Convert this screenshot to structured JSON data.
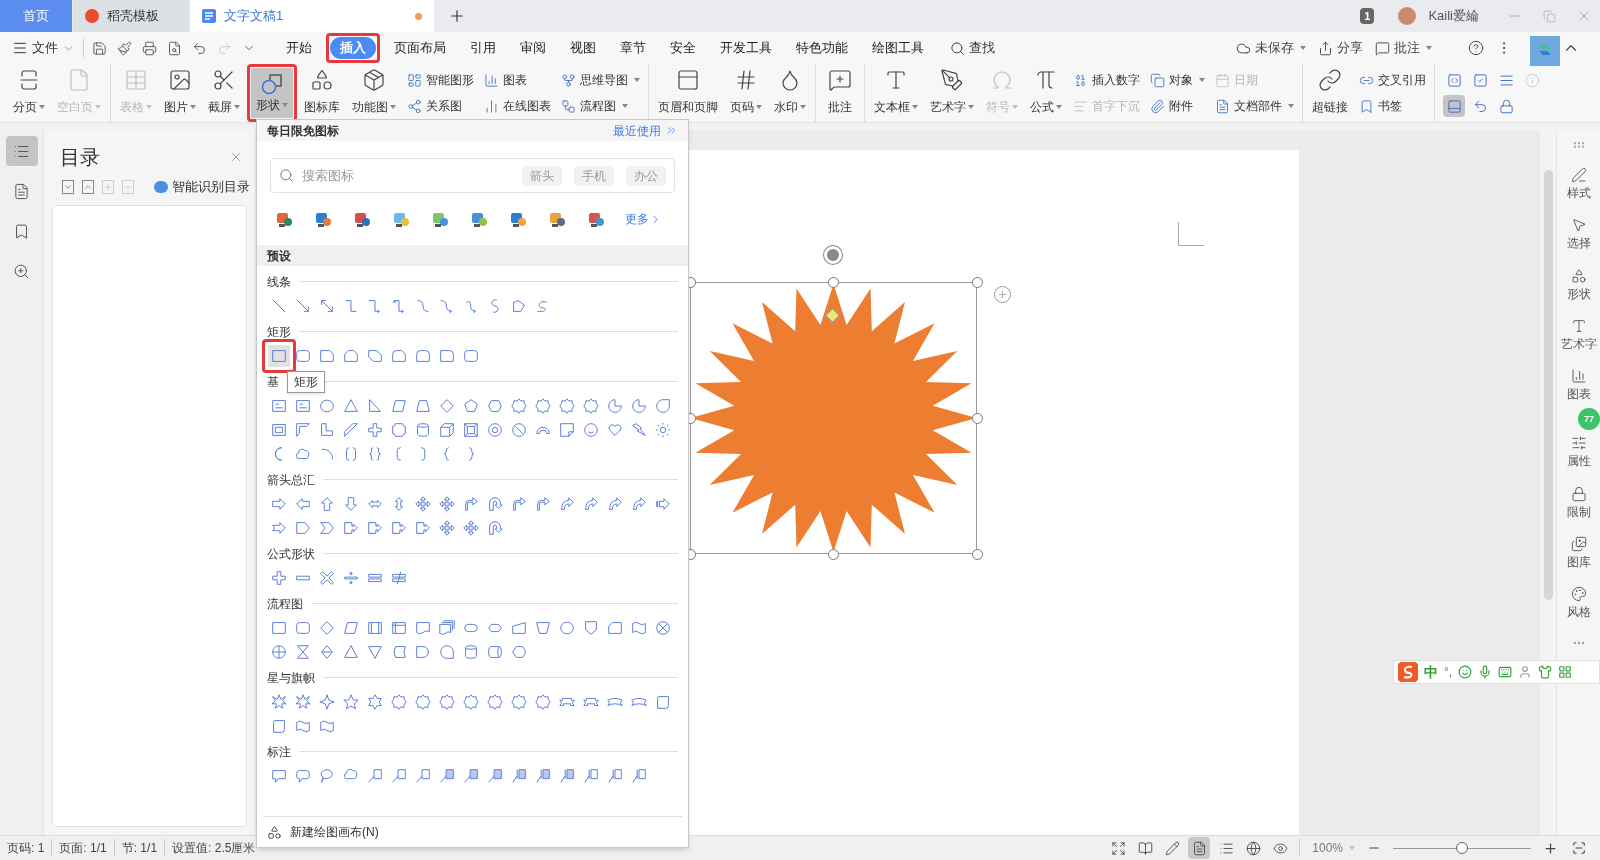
{
  "tabs": [
    {
      "label": "首页",
      "kind": "home",
      "selected": false,
      "unsaved": false
    },
    {
      "label": "稻壳模板",
      "kind": "template",
      "selected": false,
      "unsaved": false
    },
    {
      "label": "文字文稿1",
      "kind": "document",
      "selected": true,
      "unsaved": true
    }
  ],
  "account": {
    "page_count": "1",
    "name": "Kaili爱綸"
  },
  "menu": {
    "file": "文件",
    "items": [
      {
        "label": "开始",
        "selected": false,
        "annotated": false
      },
      {
        "label": "插入",
        "selected": true,
        "annotated": true
      },
      {
        "label": "页面布局",
        "selected": false,
        "annotated": false
      },
      {
        "label": "引用",
        "selected": false,
        "annotated": false
      },
      {
        "label": "审阅",
        "selected": false,
        "annotated": false
      },
      {
        "label": "视图",
        "selected": false,
        "annotated": false
      },
      {
        "label": "章节",
        "selected": false,
        "annotated": false
      },
      {
        "label": "安全",
        "selected": false,
        "annotated": false
      },
      {
        "label": "开发工具",
        "selected": false,
        "annotated": false
      },
      {
        "label": "特色功能",
        "selected": false,
        "annotated": false
      },
      {
        "label": "绘图工具",
        "selected": false,
        "annotated": false
      }
    ],
    "search": "查找",
    "right": [
      {
        "label": "未保存",
        "caret": true
      },
      {
        "label": "分享",
        "caret": false
      },
      {
        "label": "批注",
        "caret": true
      }
    ]
  },
  "ribbon": [
    {
      "items": [
        {
          "kind": "large",
          "label": "分页",
          "caret": true,
          "disabled": false,
          "pressed": false,
          "annotated": false
        },
        {
          "kind": "large",
          "label": "空白页",
          "caret": true,
          "disabled": true,
          "pressed": false,
          "annotated": false
        }
      ]
    },
    {
      "items": [
        {
          "kind": "large",
          "label": "表格",
          "caret": true,
          "disabled": true,
          "pressed": false,
          "annotated": false
        },
        {
          "kind": "large",
          "label": "图片",
          "caret": true,
          "disabled": false,
          "pressed": false,
          "annotated": false
        },
        {
          "kind": "large",
          "label": "截屏",
          "caret": true,
          "disabled": false,
          "pressed": false,
          "annotated": false
        },
        {
          "kind": "large",
          "label": "形状",
          "caret": true,
          "disabled": false,
          "pressed": true,
          "annotated": true
        },
        {
          "kind": "large",
          "label": "图标库",
          "caret": false,
          "disabled": false,
          "pressed": false,
          "annotated": false
        },
        {
          "kind": "large",
          "label": "功能图",
          "caret": true,
          "disabled": false,
          "pressed": false,
          "annotated": false
        },
        {
          "kind": "stack",
          "items": [
            {
              "label": "智能图形",
              "caret": false,
              "disabled": false
            },
            {
              "label": "关系图",
              "caret": false,
              "disabled": false
            }
          ]
        },
        {
          "kind": "stack",
          "items": [
            {
              "label": "图表",
              "caret": false,
              "disabled": false
            },
            {
              "label": "在线图表",
              "caret": false,
              "disabled": false
            }
          ]
        },
        {
          "kind": "stack",
          "items": [
            {
              "label": "思维导图",
              "caret": true,
              "disabled": false
            },
            {
              "label": "流程图",
              "caret": true,
              "disabled": false
            }
          ]
        }
      ]
    },
    {
      "items": [
        {
          "kind": "large",
          "label": "页眉和页脚",
          "caret": false,
          "disabled": false,
          "pressed": false,
          "annotated": false
        },
        {
          "kind": "large",
          "label": "页码",
          "caret": true,
          "disabled": false,
          "pressed": false,
          "annotated": false
        },
        {
          "kind": "large",
          "label": "水印",
          "caret": true,
          "disabled": false,
          "pressed": false,
          "annotated": false
        }
      ]
    },
    {
      "items": [
        {
          "kind": "large",
          "label": "批注",
          "caret": false,
          "disabled": false,
          "pressed": false,
          "annotated": false
        }
      ]
    },
    {
      "items": [
        {
          "kind": "large",
          "label": "文本框",
          "caret": true,
          "disabled": false,
          "pressed": false,
          "annotated": false
        },
        {
          "kind": "large",
          "label": "艺术字",
          "caret": true,
          "disabled": false,
          "pressed": false,
          "annotated": false
        },
        {
          "kind": "large",
          "label": "符号",
          "caret": true,
          "disabled": true,
          "pressed": false,
          "annotated": false
        },
        {
          "kind": "large",
          "label": "公式",
          "caret": true,
          "disabled": false,
          "pressed": false,
          "annotated": false
        },
        {
          "kind": "stack",
          "items": [
            {
              "label": "插入数字",
              "caret": false,
              "disabled": false
            },
            {
              "label": "首字下沉",
              "caret": false,
              "disabled": true
            }
          ]
        },
        {
          "kind": "stack",
          "items": [
            {
              "label": "对象",
              "caret": true,
              "disabled": false
            },
            {
              "label": "附件",
              "caret": false,
              "disabled": false
            }
          ]
        },
        {
          "kind": "stack",
          "items": [
            {
              "label": "日期",
              "caret": false,
              "disabled": true
            },
            {
              "label": "文档部件",
              "caret": true,
              "disabled": false
            }
          ]
        }
      ]
    },
    {
      "items": [
        {
          "kind": "large",
          "label": "超链接",
          "caret": false,
          "disabled": false,
          "pressed": false,
          "annotated": false
        },
        {
          "kind": "stack",
          "items": [
            {
              "label": "交叉引用",
              "caret": false,
              "disabled": false
            },
            {
              "label": "书签",
              "caret": false,
              "disabled": false
            }
          ]
        }
      ]
    },
    {
      "items": [
        {
          "kind": "grid",
          "cells": [
            {
              "pressed": false,
              "disabled": false
            },
            {
              "pressed": false,
              "disabled": false
            },
            {
              "pressed": false,
              "disabled": false
            },
            {
              "pressed": false,
              "disabled": true
            },
            {
              "pressed": true,
              "disabled": false
            },
            {
              "pressed": false,
              "disabled": false
            },
            {
              "pressed": false,
              "disabled": false
            }
          ]
        }
      ]
    }
  ],
  "left_tools": [
    {
      "selected": true
    },
    {
      "selected": false
    },
    {
      "selected": false
    },
    {
      "selected": false
    }
  ],
  "nav": {
    "title": "目录",
    "tools": [
      {
        "disabled": false
      },
      {
        "disabled": false
      },
      {
        "disabled": true
      },
      {
        "disabled": true
      }
    ],
    "smart": "智能识别目录"
  },
  "shape_panel": {
    "header": "每日限免图标",
    "recent": "最近使用",
    "search_placeholder": "搜索图标",
    "chips": [
      "箭头",
      "手机",
      "办公"
    ],
    "more": "更多",
    "preset": "预设",
    "sections": [
      {
        "title": "线条",
        "first_annotated": false
      },
      {
        "title": "矩形",
        "first_annotated": true
      },
      {
        "title": "基",
        "first_annotated": false
      },
      {
        "title": "箭头总汇",
        "first_annotated": false
      },
      {
        "title": "公式形状",
        "first_annotated": false
      },
      {
        "title": "流程图",
        "first_annotated": false
      },
      {
        "title": "星与旗帜",
        "first_annotated": false
      },
      {
        "title": "标注",
        "first_annotated": false
      }
    ],
    "tooltip": "矩形",
    "footer": "新建绘图画布(N)"
  },
  "sidebar": [
    {
      "label": "样式"
    },
    {
      "label": "选择"
    },
    {
      "label": "形状"
    },
    {
      "label": "艺术字"
    },
    {
      "label": "图表"
    },
    {
      "label": "属性"
    },
    {
      "label": "限制"
    },
    {
      "label": "图库"
    },
    {
      "label": "风格"
    }
  ],
  "floating_badge": "77",
  "ime": {
    "mode": "中",
    "punct": "°,"
  },
  "status": {
    "items": [
      "页码: 1",
      "页面: 1/1",
      "节: 1/1",
      "设置值: 2.5厘米"
    ],
    "views": [
      {
        "selected": false
      },
      {
        "selected": false
      },
      {
        "selected": false
      },
      {
        "selected": true
      },
      {
        "selected": false
      },
      {
        "selected": false
      },
      {
        "selected": false
      }
    ],
    "zoom": "100%",
    "zoom_slider": {
      "level": 0.5
    }
  }
}
